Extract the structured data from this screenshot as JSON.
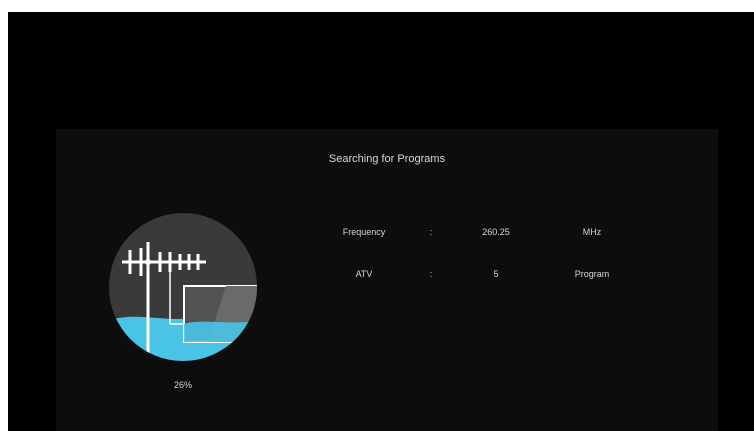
{
  "dialog": {
    "title": "Searching for Programs",
    "progress_text": "26%",
    "progress_fraction": 0.26
  },
  "info": {
    "rows": [
      {
        "label": "Frequency",
        "separator": ":",
        "value": "260.25",
        "unit": "MHz"
      },
      {
        "label": "ATV",
        "separator": ":",
        "value": "5",
        "unit": "Program"
      }
    ]
  },
  "colors": {
    "accent_water": "#4ac4e6",
    "circle_bg": "#3a3a3a",
    "screen_bg": "#000000",
    "panel_bg": "#0d0d0d"
  },
  "icons": {
    "progress": "antenna-tv-icon"
  }
}
